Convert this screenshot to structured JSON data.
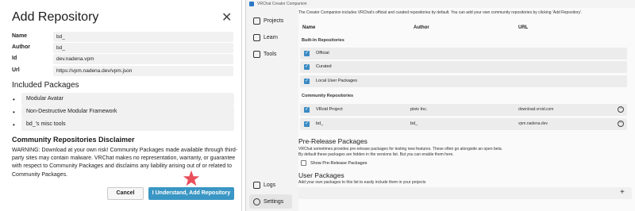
{
  "dialog": {
    "title": "Add Repository",
    "fields": [
      {
        "label": "Name",
        "value": "bd_"
      },
      {
        "label": "Author",
        "value": "bd_"
      },
      {
        "label": "Id",
        "value": "dev.nadena.vpm"
      },
      {
        "label": "Url",
        "value": "https://vpm.nadena.dev/vpm.json"
      }
    ],
    "included_heading": "Included Packages",
    "packages": [
      "Modular Avatar",
      "Non-Destructive Modular Framework",
      "bd_'s misc tools"
    ],
    "disclaimer_heading": "Community Repositories Disclaimer",
    "disclaimer_text": "WARNING: Download at your own risk! Community Packages made available through third-party sites may contain malware. VRChat makes no representation, warranty, or guarantee with respect to Community Packages and disclaims any liability arising out of or related to Community Packages.",
    "cancel_label": "Cancel",
    "accept_label": "I Understand, Add Repository",
    "accent_color": "#3a96c4",
    "marker_color": "#e94e5b"
  },
  "app": {
    "window_title": "VRChat Creator Companion",
    "nav": [
      {
        "label": "Projects",
        "icon": "projects-icon"
      },
      {
        "label": "Learn",
        "icon": "learn-icon"
      },
      {
        "label": "Tools",
        "icon": "tools-icon"
      }
    ],
    "nav_bottom": [
      {
        "label": "Logs",
        "icon": "logs-icon"
      },
      {
        "label": "Settings",
        "icon": "gear-icon"
      }
    ],
    "intro": "The Creator Companion includes VRChat's official and curated repositories by default. You can add your own community repositories by clicking 'Add Repository'.",
    "columns": {
      "name": "Name",
      "author": "Author",
      "url": "URL"
    },
    "builtin_heading": "Built-In Repositories",
    "builtin": [
      "Official",
      "Curated",
      "Local User Packages"
    ],
    "community_heading": "Community Repositories",
    "community": [
      {
        "name": "VRoid Project",
        "author": "pixiv Inc.",
        "url": "download.vroid.com"
      },
      {
        "name": "bd_",
        "author": "bd_",
        "url": "vpm.nadena.dev"
      }
    ],
    "prerelease_heading": "Pre-Release Packages",
    "prerelease_text1": "VRChat sometimes provides pre-release packages for testing new features. These often go alongside an open beta.",
    "prerelease_text2": "By default these packages are hidden in the versions list. But you can enable them here.",
    "prerelease_checkbox": "Show Pre-Release Packages",
    "user_heading": "User Packages",
    "user_text": "Add your own packages to this list to easily include them in your projects",
    "check_color": "#3a8ac4"
  }
}
